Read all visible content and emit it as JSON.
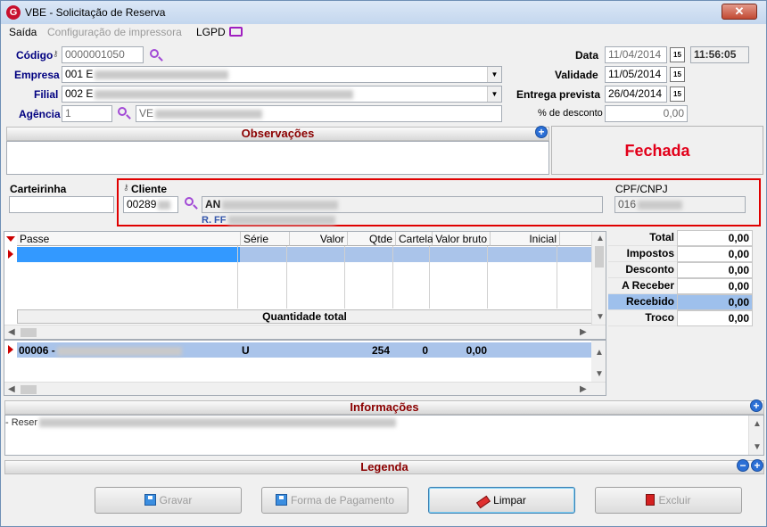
{
  "window": {
    "title": "VBE - Solicitação de Reserva",
    "close_symbol": "✕",
    "logo_letter": "G"
  },
  "menu": {
    "saida": "Saída",
    "config": "Configuração de impressora",
    "lgpd": "LGPD"
  },
  "form": {
    "codigo_label": "Código",
    "codigo_value": "0000001050",
    "empresa_label": "Empresa",
    "empresa_value": "001 E",
    "filial_label": "Filial",
    "filial_value": "002 E",
    "agencia_label": "Agência",
    "agencia_value": "1",
    "agencia_desc": "VE",
    "data_label": "Data",
    "data_value": "11/04/2014",
    "hora_value": "11:56:05",
    "validade_label": "Validade",
    "validade_value": "11/05/2014",
    "entrega_label": "Entrega prevista",
    "entrega_value": "26/04/2014",
    "desconto_label": "% de desconto",
    "desconto_value": "0,00",
    "cal_glyph": "15"
  },
  "observacoes": {
    "title": "Observações"
  },
  "status": {
    "text": "Fechada"
  },
  "carteirinha": {
    "label": "Carteirinha"
  },
  "cliente": {
    "label": "Cliente",
    "codigo": "00289",
    "nome": "AN",
    "endereco": "R. FF",
    "cpf_label": "CPF/CNPJ",
    "cpf_value": "016"
  },
  "grid": {
    "columns": [
      "Passe",
      "Série",
      "Valor",
      "Qtde",
      "Cartela",
      "Valor bruto",
      "Inicial"
    ],
    "footer": "Quantidade total"
  },
  "grid2": {
    "row": {
      "passe": "00006 -",
      "serie": "U",
      "qtde": "254",
      "cartela": "0",
      "valor_bruto": "0,00"
    }
  },
  "totals": [
    {
      "label": "Total",
      "value": "0,00"
    },
    {
      "label": "Impostos",
      "value": "0,00"
    },
    {
      "label": "Desconto",
      "value": "0,00"
    },
    {
      "label": "A Receber",
      "value": "0,00"
    },
    {
      "label": "Recebido",
      "value": "0,00"
    },
    {
      "label": "Troco",
      "value": "0,00"
    }
  ],
  "informacoes": {
    "title": "Informações",
    "text": "- Reser"
  },
  "legenda": {
    "title": "Legenda"
  },
  "buttons": {
    "gravar": "Gravar",
    "forma": "Forma de Pagamento",
    "limpar": "Limpar",
    "excluir": "Excluir"
  }
}
